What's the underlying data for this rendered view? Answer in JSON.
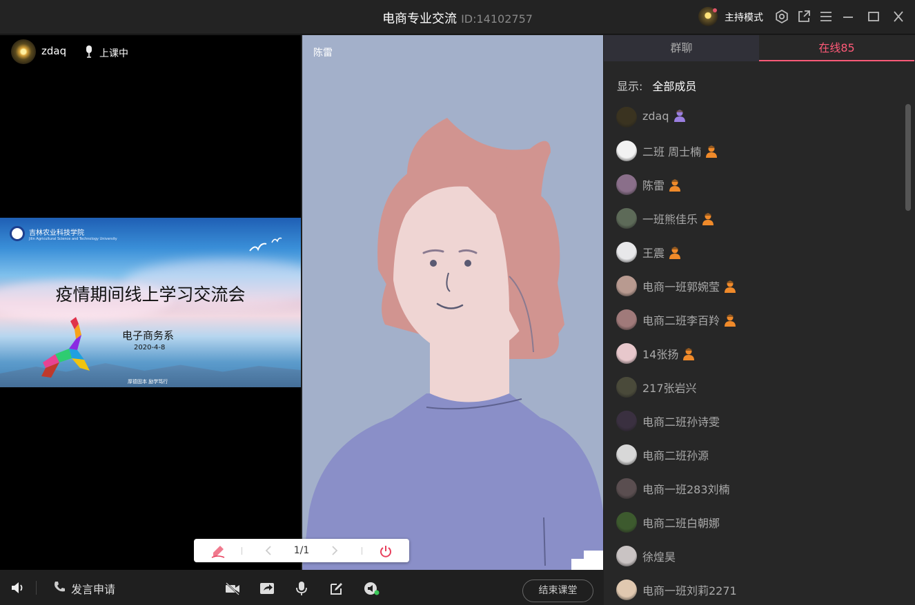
{
  "window": {
    "title": "电商专业交流",
    "room_id": "ID:14102757",
    "mode_label": "主持模式"
  },
  "teacher": {
    "name": "zdaq",
    "status": "上课中"
  },
  "slide": {
    "school": "吉林农业科技学院",
    "school_en": "Jilin Agricultural Science and Technology University",
    "title": "疫情期间线上学习交流会",
    "department": "电子商务系",
    "date": "2020-4-8",
    "motto": "厚德固本  励学笃行"
  },
  "center_video": {
    "name": "陈雷"
  },
  "float_toolbar": {
    "page": "1/1"
  },
  "bottom_bar": {
    "request_label": "发言申请",
    "end_label": "结束课堂"
  },
  "side": {
    "tab_chat": "群聊",
    "tab_online": "在线85",
    "filter_label": "显示:",
    "filter_value": "全部成员",
    "members": [
      {
        "name": "zdaq",
        "badge": "host",
        "avatar": "#3a3320"
      },
      {
        "name": "二班 周士楠",
        "badge": "student",
        "avatar": "#f2f2f2"
      },
      {
        "name": "陈雷",
        "badge": "student",
        "avatar": "#8a6f8a"
      },
      {
        "name": "一班熊佳乐",
        "badge": "student",
        "avatar": "#5d6a58"
      },
      {
        "name": "王震",
        "badge": "student",
        "avatar": "#e8e8ea"
      },
      {
        "name": "电商一班郭婉莹",
        "badge": "student",
        "avatar": "#b89a90"
      },
      {
        "name": "电商二班李百羚",
        "badge": "student",
        "avatar": "#a07a7a"
      },
      {
        "name": "14张扬",
        "badge": "student",
        "avatar": "#e8c8cc"
      },
      {
        "name": "217张岩兴",
        "badge": "",
        "avatar": "#4a4a3a"
      },
      {
        "name": "电商二班孙诗雯",
        "badge": "",
        "avatar": "#3a3040"
      },
      {
        "name": "电商二班孙源",
        "badge": "",
        "avatar": "#d8d8d8"
      },
      {
        "name": "电商一班283刘楠",
        "badge": "",
        "avatar": "#5a4e50"
      },
      {
        "name": "电商二班白朝娜",
        "badge": "",
        "avatar": "#3d5a2e"
      },
      {
        "name": "徐煌昊",
        "badge": "",
        "avatar": "#c9c3c3"
      },
      {
        "name": "电商一班刘莉2271",
        "badge": "",
        "avatar": "#e0c8b0"
      }
    ]
  },
  "colors": {
    "accent": "#ff5a78",
    "host_badge": "#9b7fe0",
    "student_badge": "#f08a2a"
  }
}
